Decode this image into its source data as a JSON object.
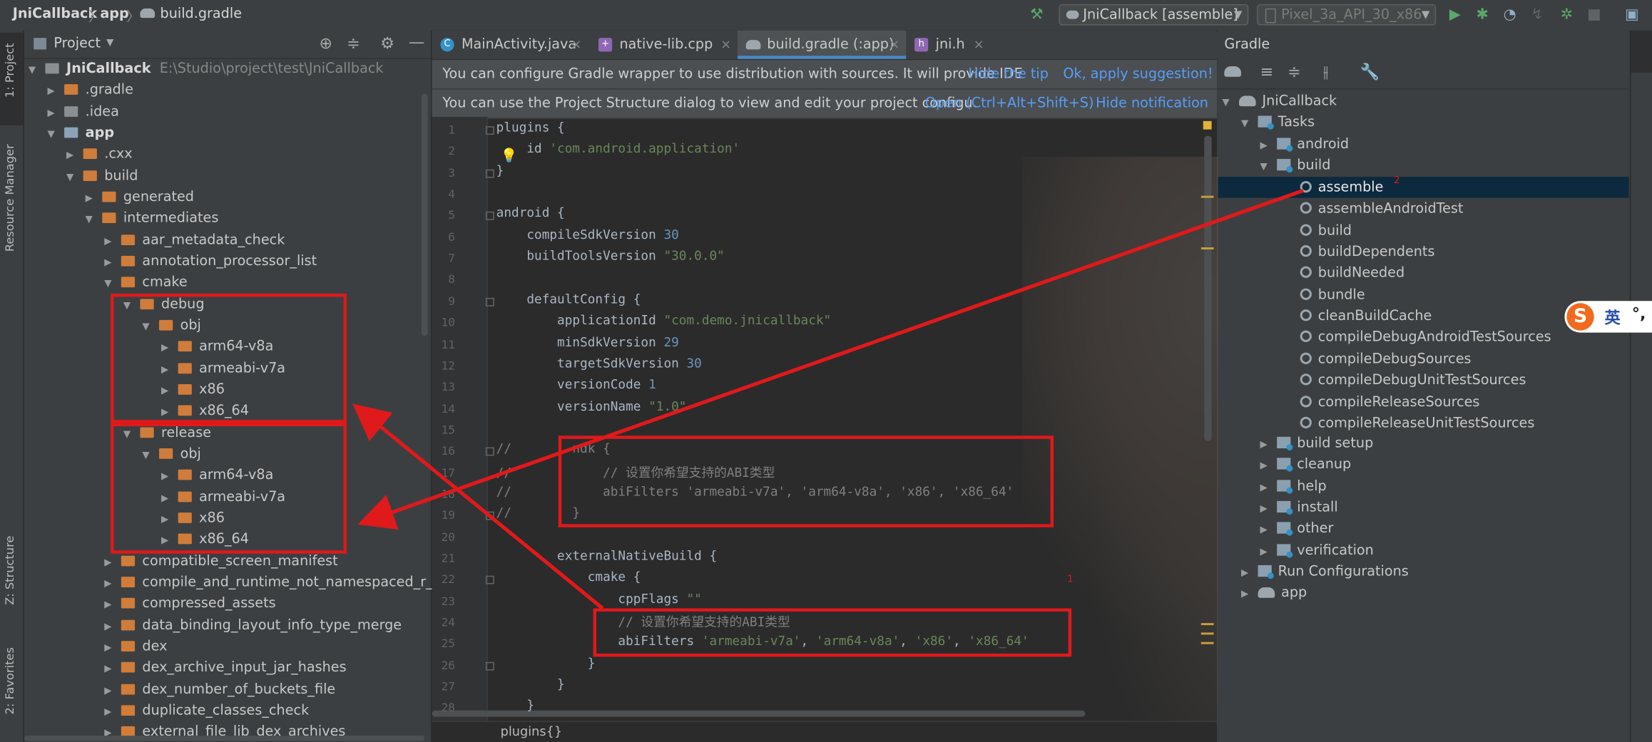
{
  "titlebar": {
    "crumbs": [
      "JniCallback",
      "app",
      "build.gradle"
    ],
    "run_config": "JniCallback [assemble]",
    "device": "Pixel_3a_API_30_x86"
  },
  "left_strip": {
    "tabs": [
      "1: Project",
      "Resource Manager",
      "Z: Structure",
      "2: Favorites"
    ]
  },
  "project": {
    "title": "Project",
    "root": {
      "name": "JniCallback",
      "path": "E:\\Studio\\project\\test\\JniCallback"
    },
    "items": [
      ".gradle",
      ".idea",
      "app",
      ".cxx",
      "build",
      "generated",
      "intermediates",
      "aar_metadata_check",
      "annotation_processor_list",
      "cmake",
      "debug",
      "obj",
      "arm64-v8a",
      "armeabi-v7a",
      "x86",
      "x86_64",
      "release",
      "obj",
      "arm64-v8a",
      "armeabi-v7a",
      "x86",
      "x86_64",
      "compatible_screen_manifest",
      "compile_and_runtime_not_namespaced_r_class",
      "compressed_assets",
      "data_binding_layout_info_type_merge",
      "dex",
      "dex_archive_input_jar_hashes",
      "dex_number_of_buckets_file",
      "duplicate_classes_check",
      "external_file_lib_dex_archives"
    ]
  },
  "editor": {
    "tabs": [
      "MainActivity.java",
      "native-lib.cpp",
      "build.gradle (:app)",
      "jni.h"
    ],
    "notices": [
      {
        "message": "You can configure Gradle wrapper to use distribution with sources. It will provide IDE",
        "links": [
          "Hide the tip",
          "Ok, apply suggestion!"
        ]
      },
      {
        "message": "You can use the Project Structure dialog to view and edit your project configu.",
        "links": [
          "Open (Ctrl+Alt+Shift+S)",
          "Hide notification"
        ]
      }
    ],
    "line_numbers": [
      "1",
      "2",
      "3",
      "4",
      "5",
      "6",
      "7",
      "8",
      "9",
      "10",
      "11",
      "12",
      "13",
      "14",
      "15",
      "16",
      "17",
      "18",
      "19",
      "20",
      "21",
      "22",
      "23",
      "24",
      "25",
      "26",
      "27",
      "28"
    ],
    "code": [
      "plugins {",
      "    id 'com.android.application'",
      "}",
      "",
      "android {",
      "    compileSdkVersion 30",
      "    buildToolsVersion \"30.0.0\"",
      "",
      "    defaultConfig {",
      "        applicationId \"com.demo.jnicallback\"",
      "        minSdkVersion 29",
      "        targetSdkVersion 30",
      "        versionCode 1",
      "        versionName \"1.0\"",
      "",
      "//        ndk {",
      "//            // 设置你希望支持的ABI类型",
      "//            abiFilters 'armeabi-v7a', 'arm64-v8a', 'x86', 'x86_64'",
      "//        }",
      "",
      "        externalNativeBuild {",
      "            cmake {",
      "                cppFlags \"\"",
      "                // 设置你希望支持的ABI类型",
      "                abiFilters 'armeabi-v7a', 'arm64-v8a', 'x86', 'x86_64'",
      "            }",
      "        }",
      "    }"
    ],
    "breadcrumb": "plugins{}"
  },
  "gradle": {
    "title": "Gradle",
    "root": "JniCallback",
    "tasks_label": "Tasks",
    "groups_before": [
      "android",
      "build"
    ],
    "build_tasks": [
      "assemble",
      "assembleAndroidTest",
      "build",
      "buildDependents",
      "buildNeeded",
      "bundle",
      "cleanBuildCache",
      "compileDebugAndroidTestSources",
      "compileDebugSources",
      "compileDebugUnitTestSources",
      "compileReleaseSources",
      "compileReleaseUnitTestSources"
    ],
    "groups_after": [
      "build setup",
      "cleanup",
      "help",
      "install",
      "other",
      "verification"
    ],
    "run_configurations": "Run Configurations",
    "app": "app"
  },
  "annotations": {
    "marker_1": "1",
    "marker_2": "2"
  },
  "ime": {
    "icon": "S",
    "mode": "英",
    "punct": "°,"
  },
  "colors": {
    "accent": "#4a88c7",
    "selection": "#0d293e",
    "annotation": "#e0191b",
    "link": "#589df6"
  }
}
